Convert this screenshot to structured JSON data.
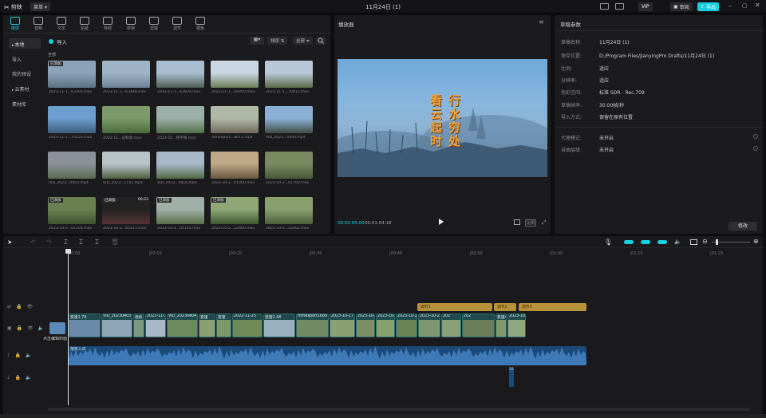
{
  "app": {
    "logo": "剪映",
    "menu": "菜单",
    "title": "11月24日 (1)",
    "buttons": {
      "vip": "VIP",
      "review": "审阅",
      "export": "导出"
    }
  },
  "media": {
    "tabs": [
      {
        "label": "媒体",
        "icon": "media-icon"
      },
      {
        "label": "音频",
        "icon": "audio-icon"
      },
      {
        "label": "文本",
        "icon": "text-icon"
      },
      {
        "label": "贴纸",
        "icon": "sticker-icon"
      },
      {
        "label": "特效",
        "icon": "effects-icon"
      },
      {
        "label": "转场",
        "icon": "transition-icon"
      },
      {
        "label": "滤镜",
        "icon": "filter-icon"
      },
      {
        "label": "调节",
        "icon": "adjust-icon"
      },
      {
        "label": "模板",
        "icon": "template-icon"
      }
    ],
    "side": [
      "本地",
      "导入",
      "我的预设",
      "云素材",
      "素材库"
    ],
    "import_label": "导入",
    "all_label": "全部",
    "sort_label": "排序",
    "filter_label": "全部",
    "items": [
      {
        "cap": "2023-11-1...63305.mov",
        "tag": "已添加"
      },
      {
        "cap": "2023-11-1...63448.mov",
        "tag": ""
      },
      {
        "cap": "2023-11-1...63834.mov",
        "tag": ""
      },
      {
        "cap": "2023-11-1...65950.mov",
        "tag": ""
      },
      {
        "cap": "2023-11-1...70012.mov",
        "tag": ""
      },
      {
        "cap": "2023-11-1...70155.mov",
        "tag": ""
      },
      {
        "cap": "2022-11...记秋意.mov",
        "tag": ""
      },
      {
        "cap": "2023-10...修平视.mov",
        "tag": ""
      },
      {
        "cap": "mmexport...8611.mp4",
        "tag": ""
      },
      {
        "cap": "VID_2023...0204.mp4",
        "tag": ""
      },
      {
        "cap": "VID_2023...0953.mp4",
        "tag": ""
      },
      {
        "cap": "VID_2023...1142.mp4",
        "tag": ""
      },
      {
        "cap": "VID_2023...4818.mp4",
        "tag": ""
      },
      {
        "cap": "2023-10-2...01900.mov",
        "tag": ""
      },
      {
        "cap": "2023-10-2...01700.mov",
        "tag": ""
      },
      {
        "cap": "2023-10-2...01104.mov",
        "tag": "已添加"
      },
      {
        "cap": "2023-10-2...65547.mov",
        "tag": "已添加",
        "dur": "00:23"
      },
      {
        "cap": "2023-10-2...01155.mov",
        "tag": "已添加"
      },
      {
        "cap": "2023-10-2...22900.mov",
        "tag": "已添加"
      },
      {
        "cap": "2023-10-2...55002.mov",
        "tag": ""
      }
    ]
  },
  "player": {
    "title": "播放器",
    "overlay1": "行水穷处",
    "overlay2": "看云起时",
    "time_current": "00:00:00:00",
    "time_total": "00:01:04:18",
    "ratio": "比例"
  },
  "draft": {
    "title": "草稿参数",
    "rows": [
      {
        "k": "草稿名称:",
        "v": "11月24日 (1)"
      },
      {
        "k": "保存位置:",
        "v": "D:/Program Files/JianyingPro Drafts/11月24日 (1)"
      },
      {
        "k": "比例:",
        "v": "适应"
      },
      {
        "k": "分辨率:",
        "v": "适应"
      },
      {
        "k": "色彩空间:",
        "v": "标准 SDR - Rec.709"
      },
      {
        "k": "草稿帧率:",
        "v": "30.00帧/秒"
      },
      {
        "k": "导入方式:",
        "v": "保留在原有位置"
      }
    ],
    "rows2": [
      {
        "k": "代理模式:",
        "v": "未开启"
      },
      {
        "k": "自由层级:",
        "v": "未开启"
      }
    ],
    "modify": "修改"
  },
  "timeline": {
    "ruler": [
      "00:00",
      "|00:10",
      "|00:20",
      "|00:30",
      "|00:40",
      "|00:50",
      "|01:00",
      "|01:10",
      "|01:20"
    ],
    "cover_tip": "点击编辑封面",
    "adjust_clips": [
      "调节1",
      "调节2",
      "调节3"
    ],
    "video_clips": [
      "变速1.7X",
      "VID_20230403",
      "烧拆",
      "2023-11-1",
      "VID_20230404",
      "变速",
      "变速",
      "2022-11-25",
      "变速2.4X",
      "mmexport1680",
      "2023-10-27",
      "2023-10-2",
      "2023-10-2",
      "2023-10-2",
      "2023-10-27 10",
      "202",
      "202",
      "变速4.5X",
      "2023-10-27 10"
    ],
    "audio_label": "落英人间",
    "small_clip": "25"
  },
  "colors": {
    "accent": "#14d0e0",
    "adjust": "#b8923a",
    "video": "#1f4a4c",
    "audio": "#1b4a78"
  }
}
